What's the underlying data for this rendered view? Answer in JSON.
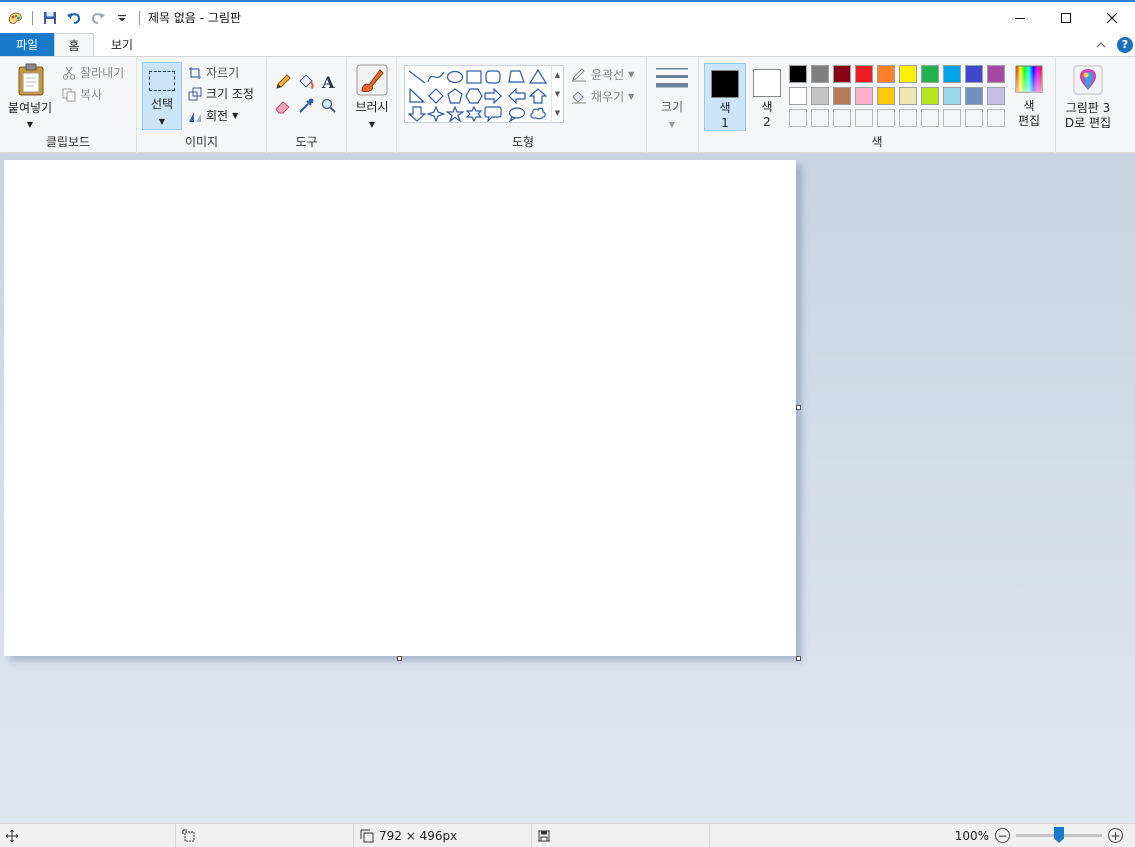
{
  "window": {
    "title": "제목 없음 - 그림판"
  },
  "tabs": [
    {
      "label": "파일"
    },
    {
      "label": "홈"
    },
    {
      "label": "보기"
    }
  ],
  "ribbon": {
    "clipboard": {
      "paste_label": "붙여넣기",
      "cut_label": "잘라내기",
      "copy_label": "복사",
      "group_label": "클립보드"
    },
    "image": {
      "select_label": "선택",
      "crop_label": "자르기",
      "resize_label": "크기 조정",
      "rotate_label": "회전",
      "group_label": "이미지"
    },
    "tools": {
      "group_label": "도구",
      "items": [
        "pencil-icon",
        "fill-bucket-icon",
        "text-icon",
        "eraser-icon",
        "color-picker-icon",
        "magnifier-icon"
      ]
    },
    "brush": {
      "label": "브러시"
    },
    "shapes": {
      "outline_label": "윤곽선",
      "fill_label": "채우기",
      "group_label": "도형"
    },
    "size": {
      "label": "크기"
    },
    "colors": {
      "color1_label_line1": "색",
      "color1_label_line2": "1",
      "color2_label_line1": "색",
      "color2_label_line2": "2",
      "color1_value": "#000000",
      "color2_value": "#ffffff",
      "edit_colors_line1": "색",
      "edit_colors_line2": "편집",
      "group_label": "색",
      "palette_row1": [
        "#000000",
        "#7f7f7f",
        "#880015",
        "#ed1c24",
        "#ff7f27",
        "#fff200",
        "#22b14c",
        "#00a2e8",
        "#3f48cc",
        "#a349a4"
      ],
      "palette_row2": [
        "#ffffff",
        "#c3c3c3",
        "#b97a57",
        "#ffaec9",
        "#ffc90e",
        "#efe4b0",
        "#b5e61d",
        "#99d9ea",
        "#7092be",
        "#c8bfe7"
      ]
    },
    "paint3d": {
      "line1": "그림판 3",
      "line2": "D로 편집"
    }
  },
  "statusbar": {
    "canvas_size": "792 × 496px",
    "zoom": "100%",
    "zoom_level": 0.5
  }
}
